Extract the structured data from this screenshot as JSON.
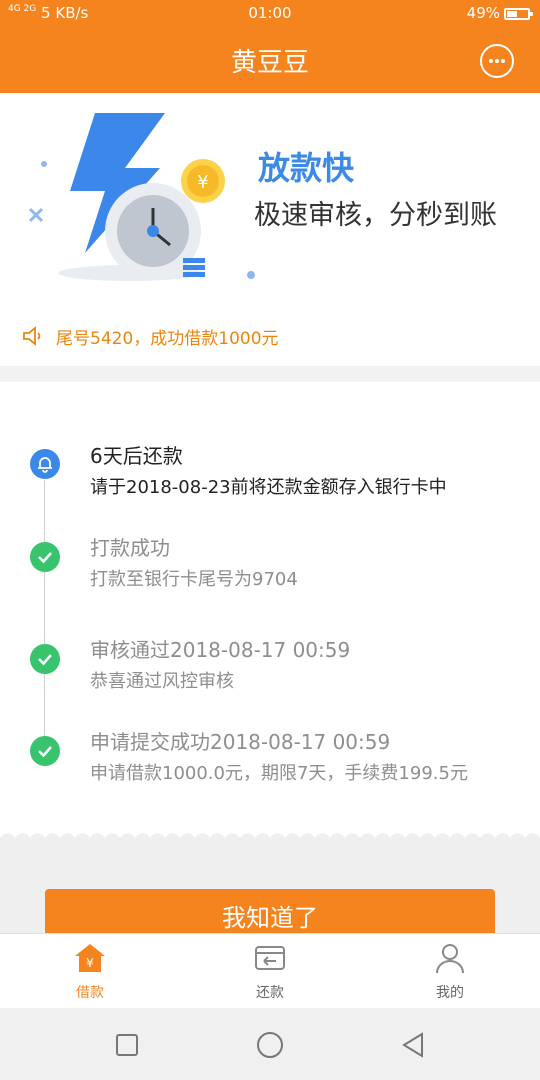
{
  "status_bar": {
    "signal_label": "4G 2G",
    "network_speed": "5 KB/s",
    "time": "01:00",
    "battery": "49%"
  },
  "header": {
    "title": "黄豆豆",
    "menu_icon": "chat-bubble-icon"
  },
  "banner": {
    "headline": "放款快",
    "subline": "极速审核，分秒到账",
    "notice": "尾号5420，成功借款1000元",
    "notice_icon": "speaker-icon"
  },
  "timeline": [
    {
      "status": "active",
      "icon": "bell-icon",
      "title": "6天后还款",
      "desc": "请于2018-08-23前将还款金额存入银行卡中"
    },
    {
      "status": "done",
      "icon": "check-icon",
      "title": "打款成功",
      "desc": "打款至银行卡尾号为9704"
    },
    {
      "status": "done",
      "icon": "check-icon",
      "title": "审核通过2018-08-17 00:59",
      "desc": "恭喜通过风控审核"
    },
    {
      "status": "done",
      "icon": "check-icon",
      "title": "申请提交成功2018-08-17 00:59",
      "desc": "申请借款1000.0元，期限7天，手续费199.5元"
    }
  ],
  "button": {
    "label": "我知道了"
  },
  "tabs": [
    {
      "label": "借款",
      "icon": "home-yen-icon",
      "active": true
    },
    {
      "label": "还款",
      "icon": "card-return-icon",
      "active": false
    },
    {
      "label": "我的",
      "icon": "user-icon",
      "active": false
    }
  ],
  "colors": {
    "accent": "#f5841f",
    "blue": "#3b87ea",
    "green": "#38c46d"
  }
}
